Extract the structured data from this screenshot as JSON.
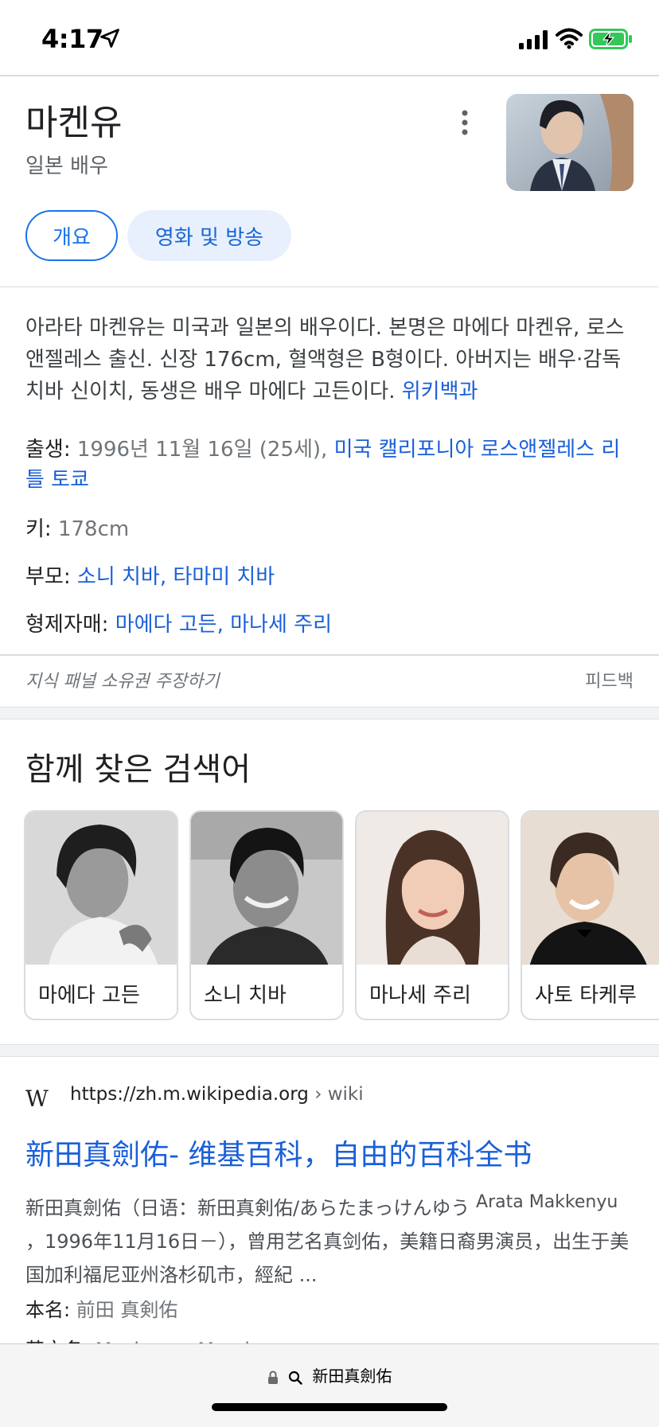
{
  "status_bar": {
    "time": "4:17"
  },
  "knowledge_panel": {
    "title": "마켄유",
    "subtitle": "일본 배우",
    "tabs": [
      {
        "label": "개요"
      },
      {
        "label": "영화 및 방송"
      }
    ],
    "description": "아라타 마켄유는 미국과 일본의 배우이다. 본명은 마에다 마켄유, 로스앤젤레스 출신. 신장 176cm, 혈액형은 B형이다. 아버지는 배우·감독 치바 신이치, 동생은 배우 마에다 고든이다.",
    "description_source": "위키백과",
    "facts": {
      "birth_label": "출생:",
      "birth_value": "1996년 11월 16일 (25세),",
      "birth_place": "미국 캘리포니아 로스앤젤레스 리틀 토쿄",
      "height_label": "키:",
      "height_value": "178cm",
      "parents_label": "부모:",
      "parent_1": "소니 치바",
      "parent_2": "타마미 치바",
      "siblings_label": "형제자매:",
      "sibling_1": "마에다 고든",
      "sibling_2": "마나세 주리",
      "separator": ","
    },
    "claim_text": "지식 패널 소유권 주장하기",
    "feedback_text": "피드백"
  },
  "people_also_search": {
    "title": "함께 찾은 검색어",
    "items": [
      {
        "label": "마에다 고든"
      },
      {
        "label": "소니 치바"
      },
      {
        "label": "마나세 주리"
      },
      {
        "label": "사토 타케루"
      }
    ]
  },
  "result": {
    "logo": "W",
    "url": "https://zh.m.wikipedia.org",
    "breadcrumb": "› wiki",
    "title": "新田真劍佑- 维基百科，自由的百科全书",
    "snippet_1": "新田真劍佑（日语：新田真剣佑/あらたまっけんゆう",
    "snippet_sup": "Arata Makkenyu",
    "snippet_2": "，1996年11月16日－），曾用艺名真剑佑，美籍日裔男演员，出生于美国加利福尼亚州洛杉矶市，經紀 ...",
    "meta_label_1": "本名:",
    "meta_value_1": "前田 真剣佑",
    "meta_label_2": "英文名:",
    "meta_value_2": "Mackenyu Maeda"
  },
  "browser": {
    "address": "新田真劍佑"
  },
  "colors": {
    "link": "#1a5fd8",
    "chip_bg": "#e8f0fe",
    "battery": "#34c759"
  }
}
